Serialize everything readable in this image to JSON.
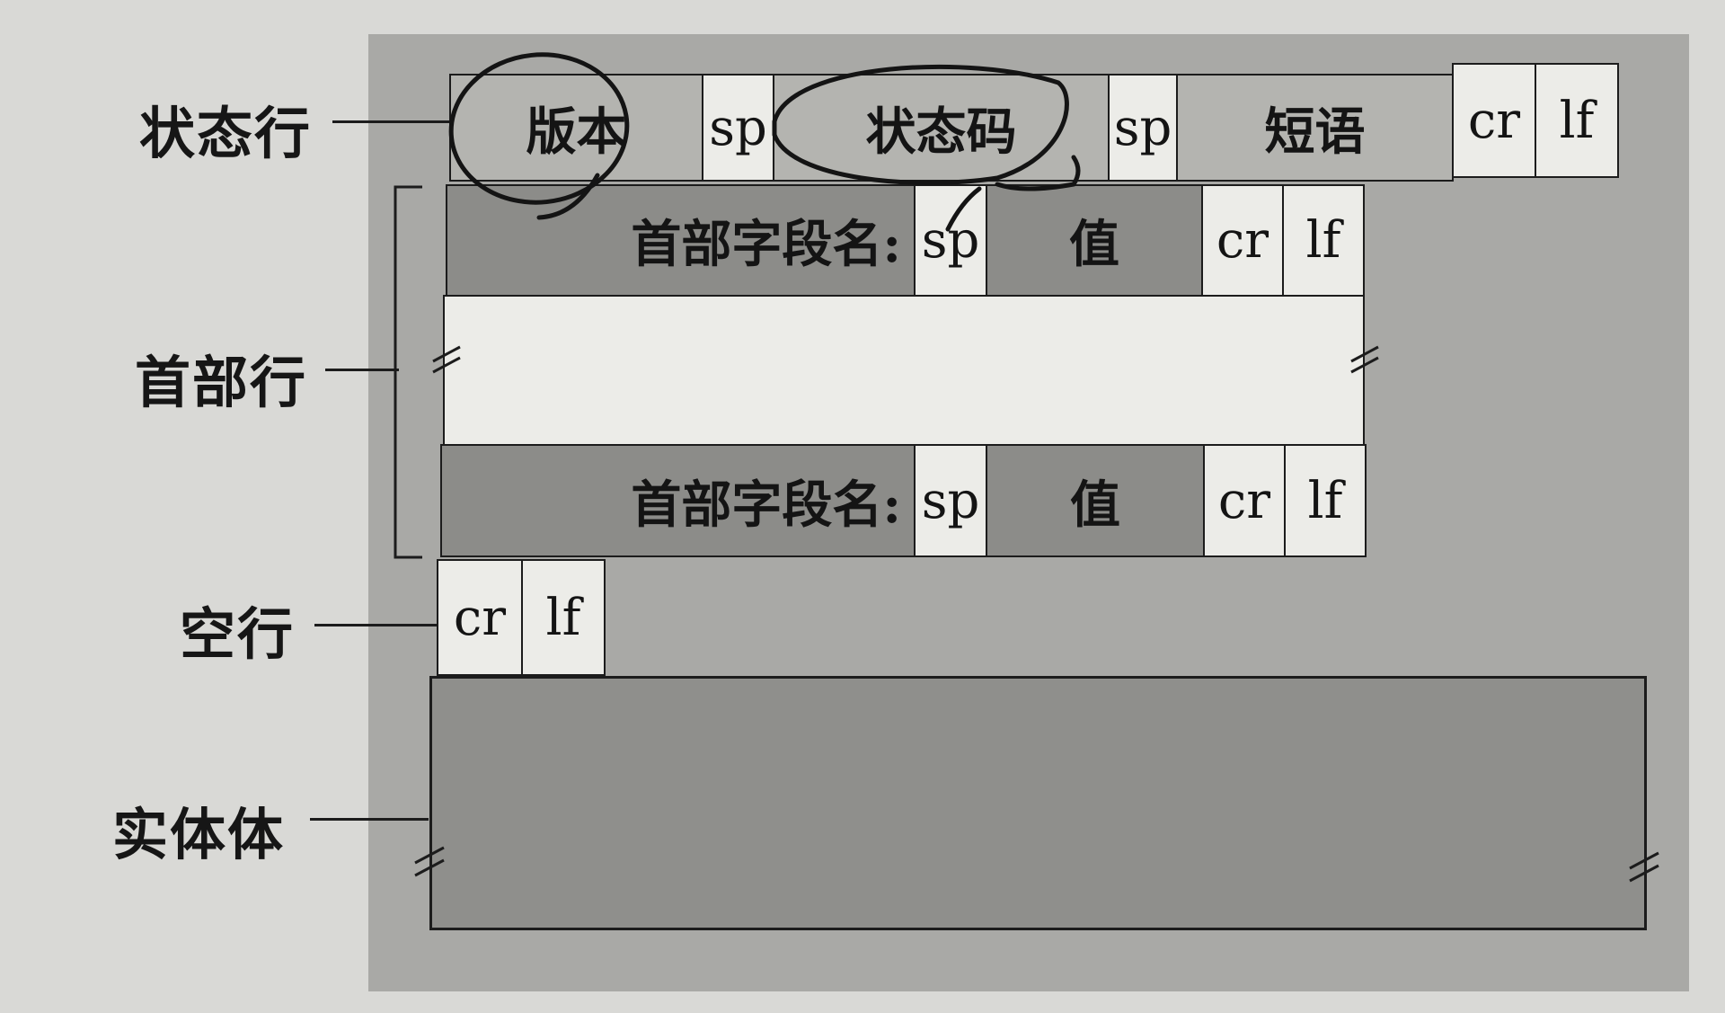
{
  "row_labels": {
    "status_line": "状态行",
    "header_lines": "首部行",
    "blank_line": "空行",
    "entity_body": "实体体"
  },
  "status_line": {
    "version": "版本",
    "sp1": "sp",
    "status_code": "状态码",
    "sp2": "sp",
    "phrase": "短语",
    "cr": "cr",
    "lf": "lf"
  },
  "header_line_1": {
    "field_name": "首部字段名:",
    "sp": "sp",
    "value": "值",
    "cr": "cr",
    "lf": "lf"
  },
  "header_line_2": {
    "field_name": "首部字段名:",
    "sp": "sp",
    "value": "值",
    "cr": "cr",
    "lf": "lf"
  },
  "blank_line": {
    "cr": "cr",
    "lf": "lf"
  },
  "annotations": {
    "circled_fields": [
      "version",
      "status_code"
    ]
  },
  "colors": {
    "background": "#d9d9d6",
    "panel": "#a9a9a6",
    "light_cell": "#ecece8",
    "mid_cell": "#b4b4b0",
    "dark_cell": "#8c8c89",
    "ink": "#1c1c1c"
  }
}
